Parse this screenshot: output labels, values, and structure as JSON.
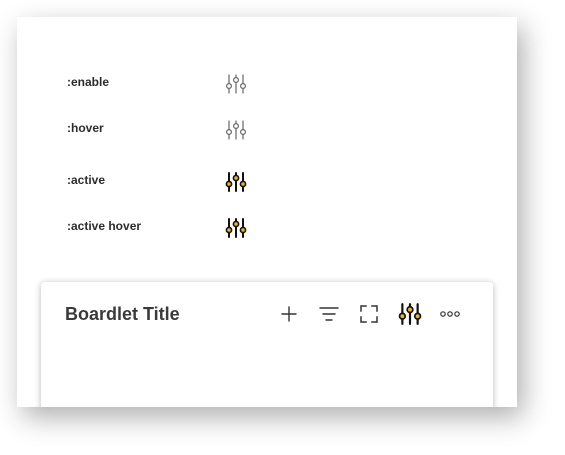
{
  "states": [
    {
      "label": ":enable",
      "icon": "sliders-icon"
    },
    {
      "label": ":hover",
      "icon": "sliders-icon"
    },
    {
      "label": ":active",
      "icon": "sliders-icon"
    },
    {
      "label": ":active hover",
      "icon": "sliders-icon"
    }
  ],
  "boardlet": {
    "title": "Boardlet Title",
    "toolbar": [
      {
        "name": "add",
        "icon": "plus-icon"
      },
      {
        "name": "filter",
        "icon": "filter-icon"
      },
      {
        "name": "fullscreen",
        "icon": "expand-icon"
      },
      {
        "name": "settings",
        "icon": "sliders-icon"
      },
      {
        "name": "more",
        "icon": "more-icon"
      }
    ]
  },
  "colors": {
    "icon_default": "#666666",
    "icon_active": "#111111",
    "accent": "#f2b705",
    "text": "#2c2c2c"
  }
}
